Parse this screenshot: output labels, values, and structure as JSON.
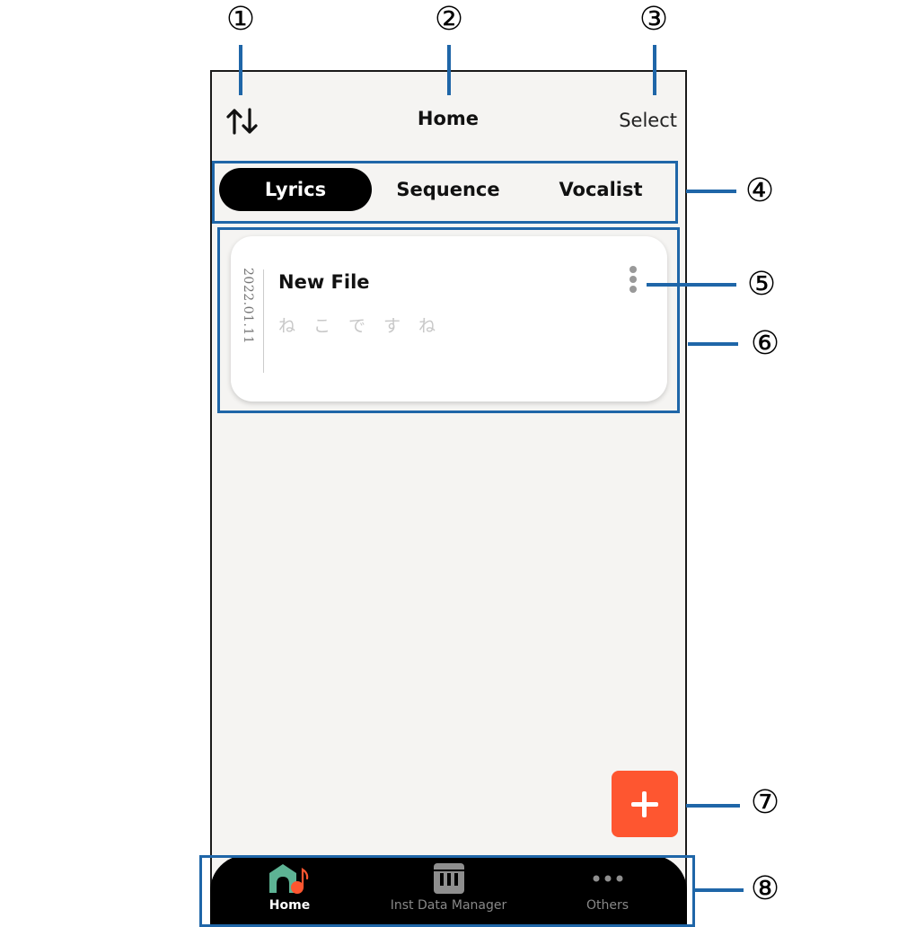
{
  "header": {
    "sort_icon": "sort-up-down-arrows",
    "title": "Home",
    "select_label": "Select"
  },
  "tabs": [
    {
      "label": "Lyrics",
      "active": true
    },
    {
      "label": "Sequence",
      "active": false
    },
    {
      "label": "Vocalist",
      "active": false
    }
  ],
  "files": [
    {
      "date": "2022.01.11",
      "title": "New File",
      "lyrics": "ねこですね",
      "menu_icon": "vertical-ellipsis"
    }
  ],
  "fab": {
    "icon": "plus",
    "color": "#fe5630"
  },
  "bottom_nav": [
    {
      "label": "Home",
      "icon": "home-music-note",
      "active": true
    },
    {
      "label": "Inst Data Manager",
      "icon": "piano-keys",
      "active": false
    },
    {
      "label": "Others",
      "icon": "horizontal-ellipsis",
      "active": false
    }
  ],
  "annotations": [
    "①",
    "②",
    "③",
    "④",
    "⑤",
    "⑥",
    "⑦",
    "⑧"
  ],
  "colors": {
    "accent": "#fe5630",
    "annotation": "#1f66a8",
    "home_icon_green": "#5db394",
    "background": "#f5f4f2"
  }
}
